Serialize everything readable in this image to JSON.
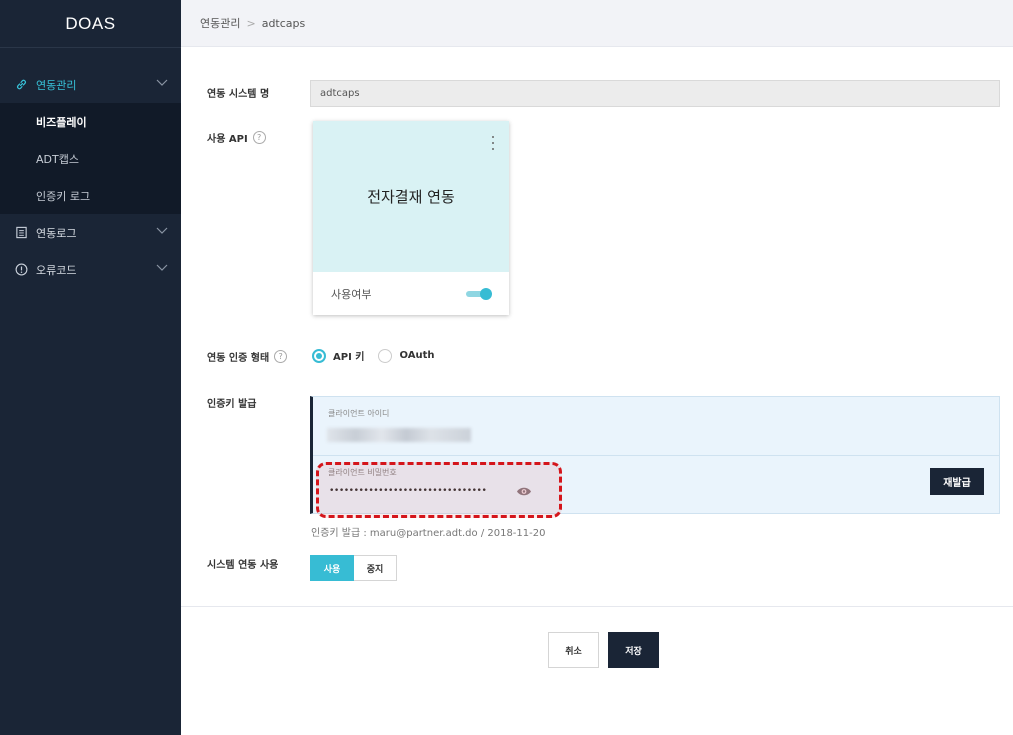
{
  "app": {
    "brand": "DOAS"
  },
  "sidebar": {
    "menu": [
      {
        "label": "연동관리",
        "icon": "link-icon",
        "active": true,
        "children": [
          {
            "label": "비즈플레이",
            "selected": true
          },
          {
            "label": "ADT캡스",
            "selected": false
          },
          {
            "label": "인증키 로그",
            "selected": false
          }
        ]
      },
      {
        "label": "연동로그",
        "icon": "document-icon"
      },
      {
        "label": "오류코드",
        "icon": "alert-circle-icon"
      }
    ]
  },
  "breadcrumb": {
    "parent": "연동관리",
    "separator": ">",
    "current": "adtcaps"
  },
  "form": {
    "system_name": {
      "label": "연동 시스템 명",
      "value": "adtcaps"
    },
    "api": {
      "label": "사용 API",
      "card_title": "전자결재 연동",
      "toggle_label": "사용여부",
      "enabled": true
    },
    "auth_type": {
      "label": "연동 인증 형태",
      "options": [
        {
          "label": "API 키",
          "selected": true
        },
        {
          "label": "OAuth",
          "selected": false
        }
      ]
    },
    "key_issue": {
      "label": "인증키 발급",
      "client_id_label": "클라이언트 아이디",
      "client_secret_label": "클라이언트 비밀번호",
      "client_secret_masked": "••••••••••••••••••••••••••••••••",
      "reissue_label": "재발급",
      "issued_info": "인증키 발급 : maru@partner.adt.do / 2018-11-20"
    },
    "system_use": {
      "label": "시스템 연동 사용",
      "on_label": "사용",
      "off_label": "중지",
      "selected": "on"
    }
  },
  "actions": {
    "cancel": "취소",
    "save": "저장"
  },
  "colors": {
    "sidebar_bg": "#1a2536",
    "accent": "#37bcd4",
    "highlight": "#d4151b"
  }
}
